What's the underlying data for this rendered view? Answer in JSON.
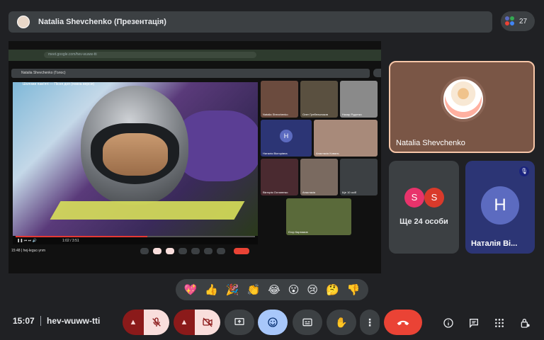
{
  "presenter_bar": {
    "title": "Natalia Shevchenko (Презентація)"
  },
  "people": {
    "count": "27",
    "icon": "people-icon"
  },
  "shared_screen": {
    "url": "meet.google.com/hev-wuww-tti",
    "inner_title": "Natalia Shevchenko (Голос)",
    "video_title": "Шоломи пам'яті — Пісня дня (повна версія)",
    "video_time": "1:02 / 3:51",
    "mini_clock": "15:48",
    "mini_code": "hej-leguc-ynm",
    "tiles": [
      {
        "name": "Natalia Shevchenko"
      },
      {
        "name": "Олег Гребельников"
      },
      {
        "name": "Назар Руденко"
      },
      {
        "name": "Наталія Вікторівна",
        "initial": "H"
      },
      {
        "name": "Анастасія Коваль"
      },
      {
        "name": "Вікторія Остапенко"
      },
      {
        "name": "Анастасія"
      },
      {
        "name": "Ще 10 осіб"
      },
      {
        "name": "Єгор Картамов"
      }
    ]
  },
  "tiles": {
    "main": {
      "name": "Natalia Shevchenko"
    },
    "more": {
      "label": "Ще 24 особи",
      "avatars": [
        "S",
        "S"
      ],
      "colors": [
        "#e8336b",
        "#d93a2b"
      ]
    },
    "natalia_v": {
      "name": "Наталія Ві...",
      "initial": "H",
      "mic_icon": "mic-off-icon"
    }
  },
  "reactions": [
    "💖",
    "👍",
    "🎉",
    "👏",
    "😂",
    "😮",
    "😢",
    "🤔",
    "👎"
  ],
  "bottom": {
    "time": "15:07",
    "code": "hev-wuww-tti"
  },
  "colors": {
    "accent": "#a8c7fa",
    "danger": "#ea4335",
    "muted_bg": "#8b1a1a"
  }
}
